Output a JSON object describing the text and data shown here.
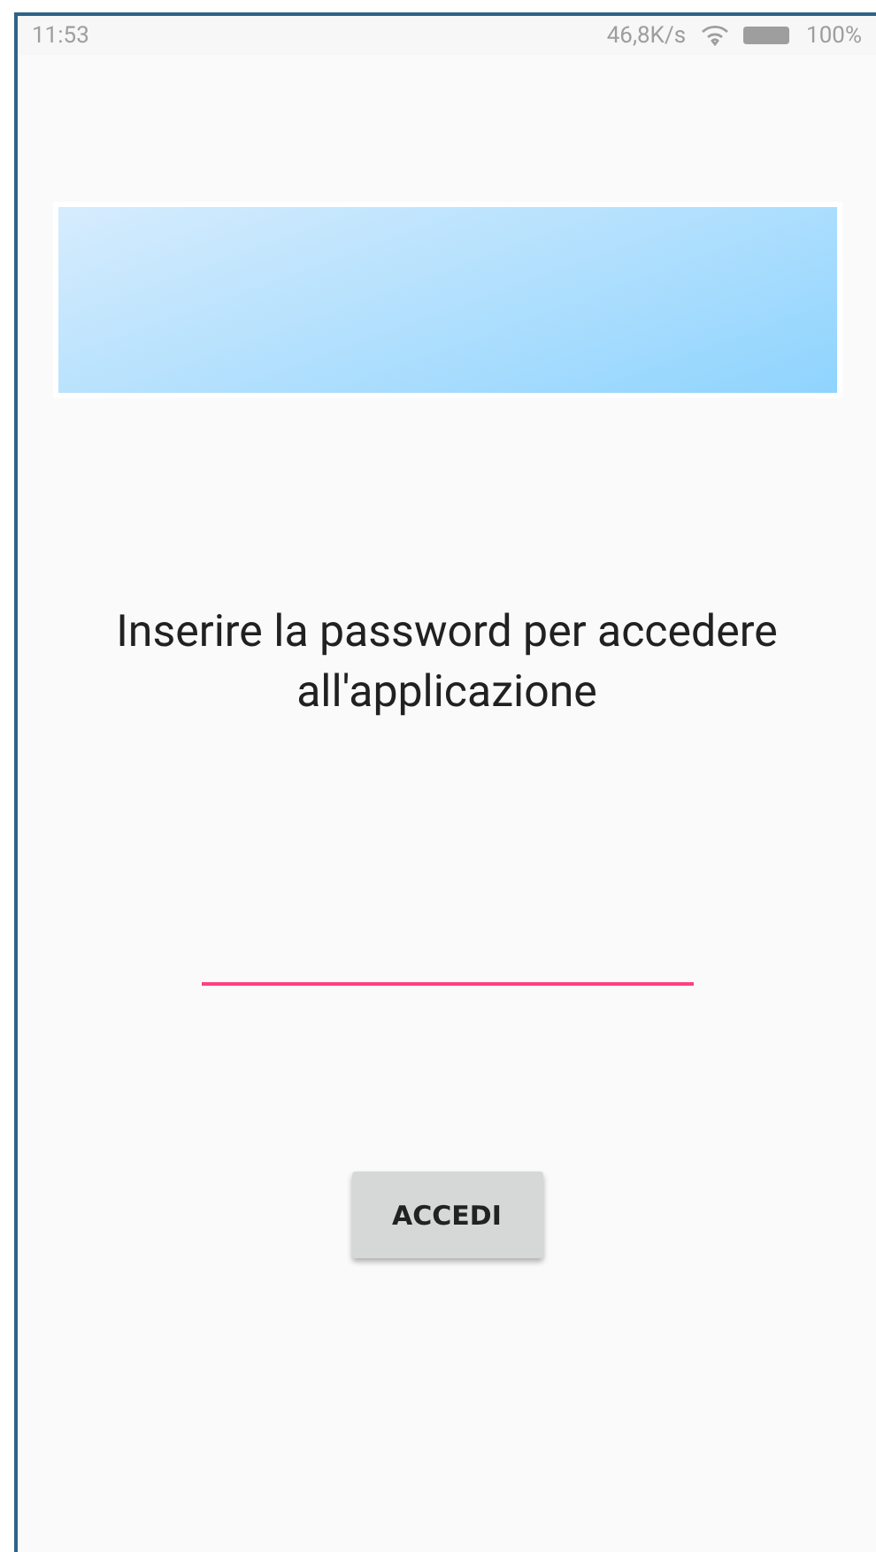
{
  "status_bar": {
    "time": "11:53",
    "speed": "46,8K/s",
    "battery": "100%"
  },
  "prompt": "Inserire la password per accedere all'applicazione",
  "password_field": {
    "focused": true
  },
  "button": "ACCEDI"
}
